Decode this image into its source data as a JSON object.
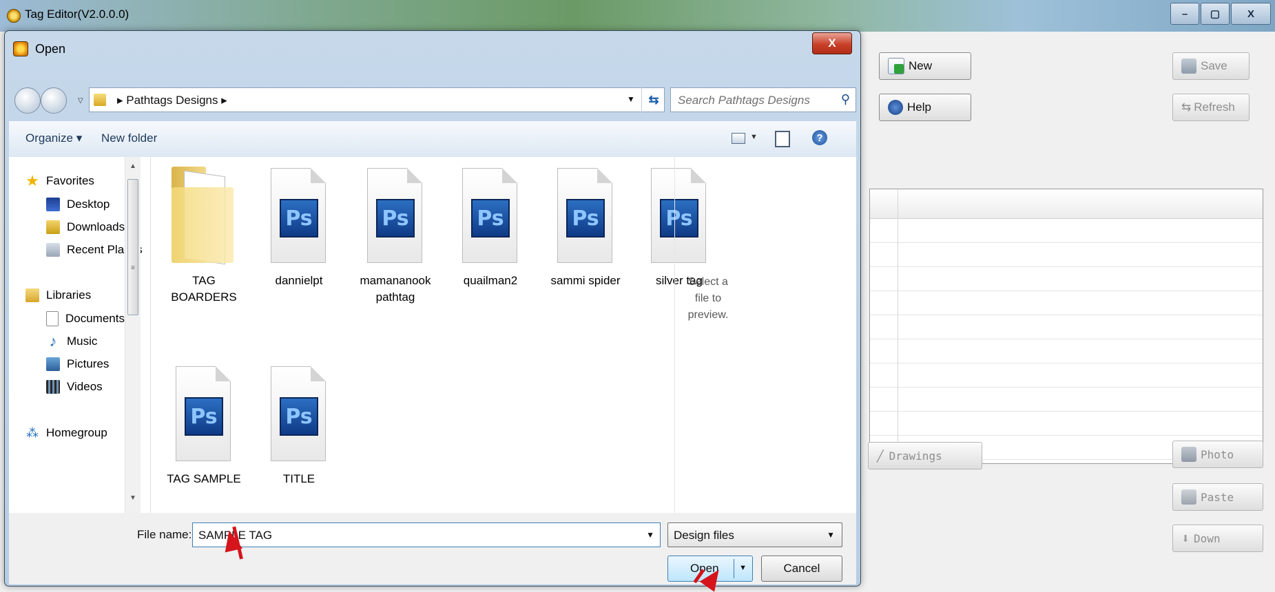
{
  "app": {
    "title": "Tag Editor(V2.0.0.0)",
    "controls": {
      "minimize": "–",
      "maximize": "▢",
      "close": "X"
    },
    "buttons": {
      "new": "New",
      "help": "Help",
      "save": "Save",
      "refresh": "Refresh",
      "drawings": "Drawings",
      "photo": "Photo",
      "paste": "Paste",
      "down": "Down"
    }
  },
  "dialog": {
    "title": "Open",
    "close": "X",
    "breadcrumb": [
      "Pathtags Designs"
    ],
    "search_placeholder": "Search Pathtags Designs",
    "toolbar": {
      "organize": "Organize ▾",
      "new_folder": "New folder"
    },
    "nav": {
      "favorites": {
        "label": "Favorites",
        "items": [
          "Desktop",
          "Downloads",
          "Recent Places"
        ]
      },
      "libraries": {
        "label": "Libraries",
        "items": [
          "Documents",
          "Music",
          "Pictures",
          "Videos"
        ]
      },
      "homegroup": "Homegroup"
    },
    "files": [
      {
        "name": "TAG BOARDERS",
        "type": "folder"
      },
      {
        "name": "dannielpt",
        "type": "psd"
      },
      {
        "name": "mamananook pathtag",
        "type": "psd"
      },
      {
        "name": "quailman2",
        "type": "psd"
      },
      {
        "name": "sammi spider",
        "type": "psd"
      },
      {
        "name": "silver tag",
        "type": "psd"
      },
      {
        "name": "TAG SAMPLE",
        "type": "psd"
      },
      {
        "name": "TITLE",
        "type": "psd"
      }
    ],
    "ps_badge": "Ps",
    "preview_text": "Select a file to preview.",
    "file_name_label": "File name:",
    "file_name_value": "SAMPLE TAG",
    "file_type_value": "Design files",
    "open_label": "Open",
    "cancel_label": "Cancel"
  },
  "colors": {
    "annotation_arrow": "#d5141c",
    "ps_blue": "#1a4f9e"
  }
}
